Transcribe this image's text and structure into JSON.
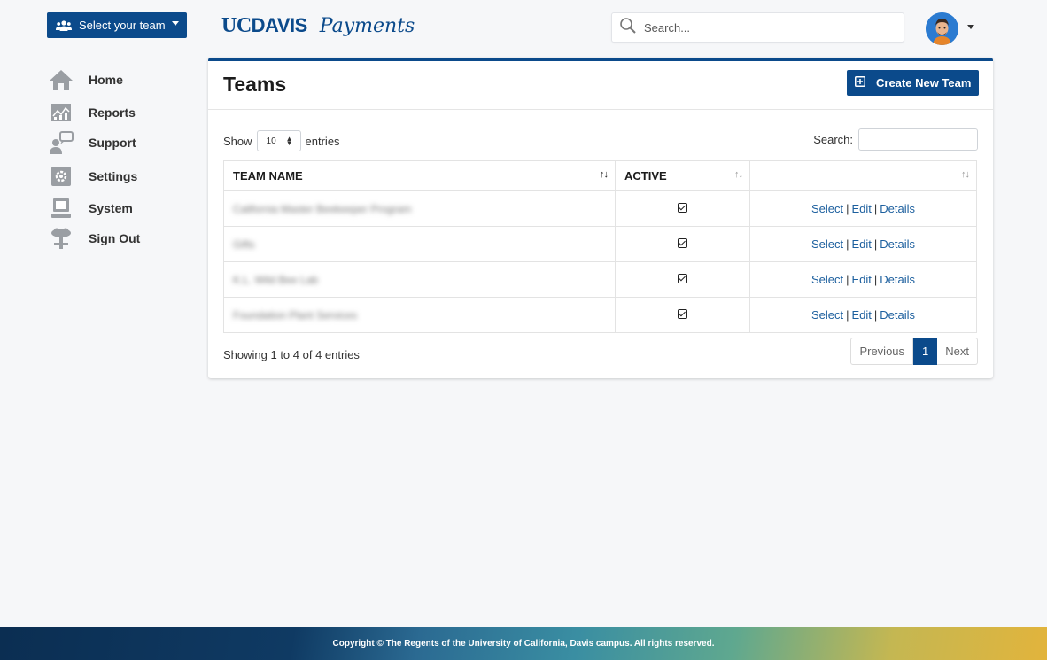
{
  "header": {
    "team_select_label": "Select your team",
    "logo_uc": "UC",
    "logo_davis": "DAVIS",
    "logo_payments": "Payments",
    "search_placeholder": "Search..."
  },
  "sidebar": {
    "items": [
      {
        "label": "Home",
        "icon": "home-icon"
      },
      {
        "label": "Reports",
        "icon": "reports-icon"
      },
      {
        "label": "Support",
        "icon": "support-icon"
      },
      {
        "label": "Settings",
        "icon": "settings-icon"
      },
      {
        "label": "System",
        "icon": "system-icon"
      },
      {
        "label": "Sign Out",
        "icon": "sign-out-icon"
      }
    ]
  },
  "card": {
    "title": "Teams",
    "create_button": "Create New Team",
    "show_label": "Show",
    "entries_value": "10",
    "entries_label": "entries",
    "search_label": "Search:",
    "columns": [
      "TEAM NAME",
      "ACTIVE",
      ""
    ],
    "rows": [
      {
        "name": "California Master Beekeeper Program",
        "active": true,
        "actions": [
          "Select",
          "Edit",
          "Details"
        ]
      },
      {
        "name": "Gifts",
        "active": true,
        "actions": [
          "Select",
          "Edit",
          "Details"
        ]
      },
      {
        "name": "K.L. Wild Bee Lab",
        "active": true,
        "actions": [
          "Select",
          "Edit",
          "Details"
        ]
      },
      {
        "name": "Foundation Plant Services",
        "active": true,
        "actions": [
          "Select",
          "Edit",
          "Details"
        ]
      }
    ],
    "info": "Showing 1 to 4 of 4 entries",
    "pager": {
      "prev": "Previous",
      "current": "1",
      "next": "Next"
    }
  },
  "footer": {
    "copyright": "Copyright © The Regents of the University of California, Davis campus. All rights reserved."
  },
  "colors": {
    "brand": "#0b4a8b",
    "link": "#1c5f9e"
  }
}
